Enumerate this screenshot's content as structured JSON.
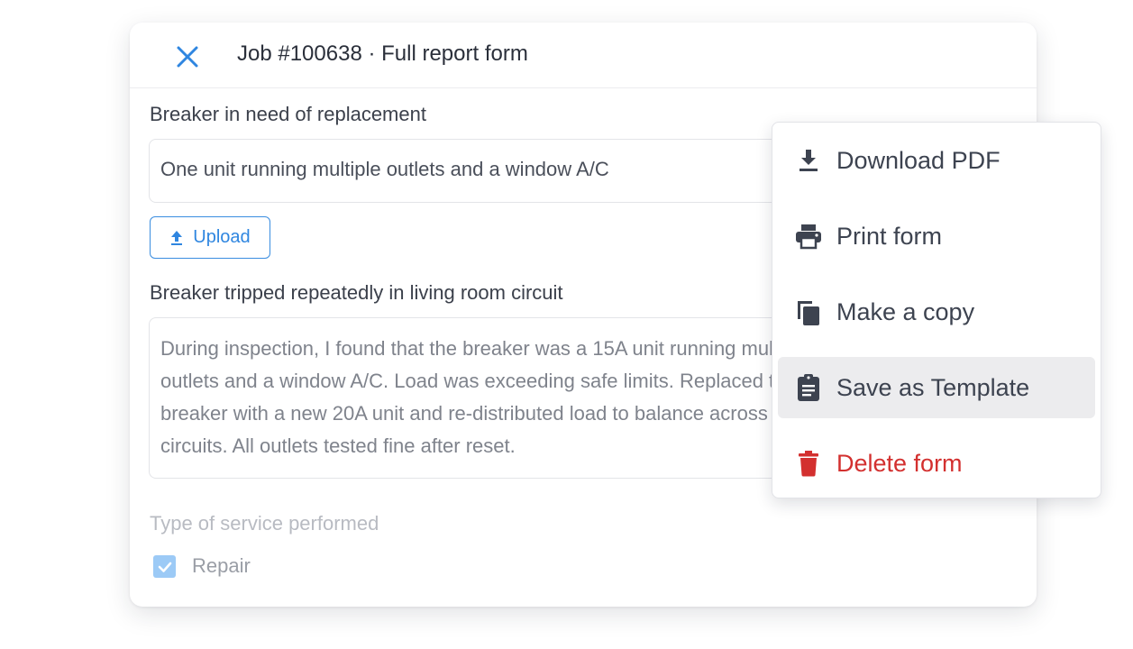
{
  "header": {
    "title": "Job #100638 · Full report form"
  },
  "form": {
    "field1_label": "Breaker in need of replacement",
    "field1_value": "One unit running multiple outlets and a window A/C",
    "upload_label": "Upload",
    "field2_label": "Breaker tripped repeatedly in living room circuit",
    "field2_value": "During inspection, I found that the breaker was a 15A unit running multiple outlets and a window A/C. Load was exceeding safe limits. Replaced the breaker with a new 20A unit and re-distributed load to balance across two circuits. All outlets tested fine after reset.",
    "service_label": "Type of service performed",
    "service_option": "Repair",
    "service_checked": true
  },
  "menu": {
    "items": [
      {
        "label": "Download PDF",
        "icon": "download-icon"
      },
      {
        "label": "Print form",
        "icon": "print-icon"
      },
      {
        "label": "Make a copy",
        "icon": "copy-icon"
      },
      {
        "label": "Save as Template",
        "icon": "clipboard-icon"
      },
      {
        "label": "Delete form",
        "icon": "trash-icon"
      }
    ],
    "highlighted": "Save as Template"
  },
  "colors": {
    "accent": "#2f86e0",
    "danger": "#d3302f",
    "checkbox": "#9ccaf6",
    "highlight": "#ececee"
  }
}
